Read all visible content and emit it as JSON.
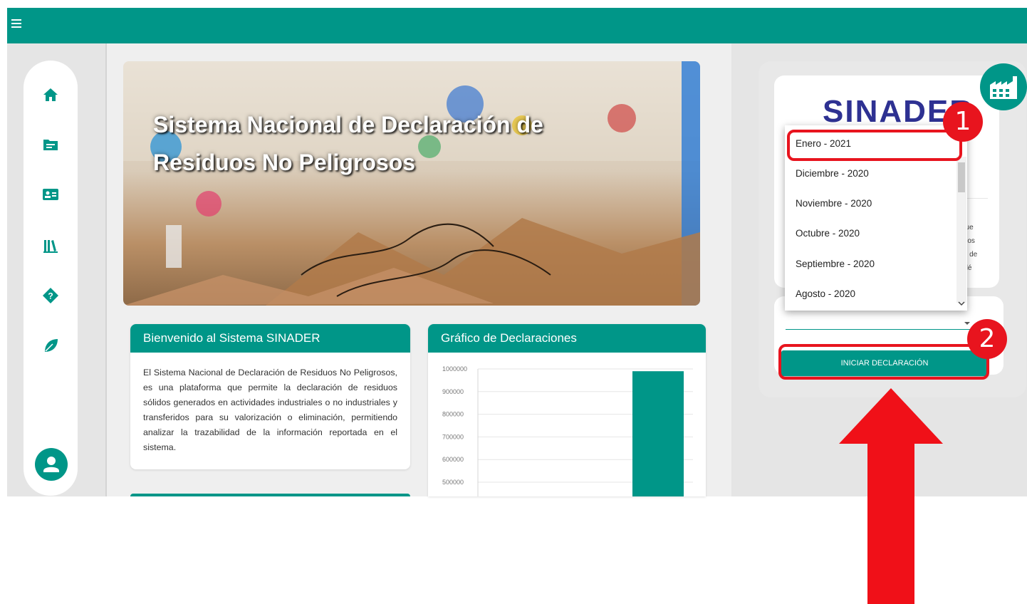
{
  "colors": {
    "accent": "#009688",
    "highlight": "#e8141e",
    "logo": "#2e3192"
  },
  "hero": {
    "title": "Sistema Nacional de Declaración de Residuos No Peligrosos"
  },
  "welcome": {
    "title": "Bienvenido al Sistema SINADER",
    "body": "El Sistema Nacional de Declaración de Residuos No Peligrosos, es una plataforma que permite la declaración de residuos sólidos generados en actividades industriales o no industriales y transferidos para su valorización o eliminación, permitiendo analizar la trazabilidad de la información reportada en el sistema."
  },
  "chart_card": {
    "title": "Gráfico de Declaraciones"
  },
  "chart_data": {
    "type": "bar",
    "values": [
      990000
    ],
    "ylim": [
      0,
      1000000
    ],
    "ticks": [
      "1000000",
      "900000",
      "800000",
      "700000",
      "600000",
      "500000"
    ],
    "grid": true
  },
  "right": {
    "logo": "SINADER",
    "side_text": [
      "l que",
      "iduos",
      "cto de",
      "o dé"
    ],
    "button_label": "INICIAR DECLARACIÓN"
  },
  "dropdown": {
    "options": [
      "Enero - 2021",
      "Diciembre - 2020",
      "Noviembre - 2020",
      "Octubre - 2020",
      "Septiembre - 2020",
      "Agosto - 2020"
    ]
  },
  "annotations": {
    "badge1": "1",
    "badge2": "2"
  },
  "icons": [
    "menu-icon",
    "home-icon",
    "folder-icon",
    "id-card-icon",
    "library-icon",
    "help-icon",
    "leaf-icon",
    "user-icon",
    "factory-icon",
    "chevron-down-icon",
    "dropdown-arrow-icon",
    "red-arrow"
  ]
}
